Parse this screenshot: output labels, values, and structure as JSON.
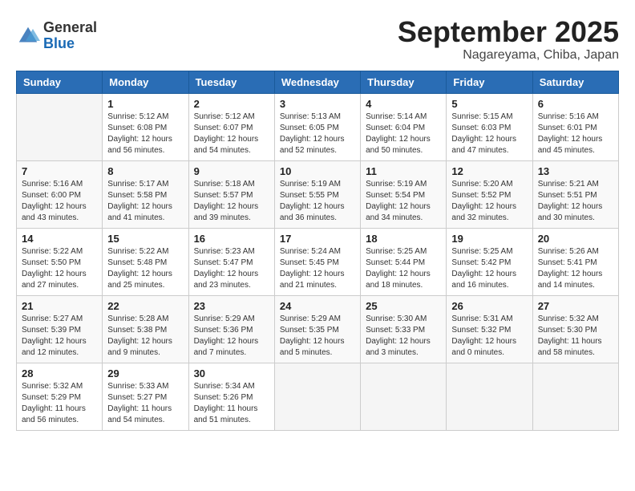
{
  "logo": {
    "general": "General",
    "blue": "Blue"
  },
  "title": "September 2025",
  "location": "Nagareyama, Chiba, Japan",
  "weekdays": [
    "Sunday",
    "Monday",
    "Tuesday",
    "Wednesday",
    "Thursday",
    "Friday",
    "Saturday"
  ],
  "weeks": [
    [
      {
        "day": "",
        "info": ""
      },
      {
        "day": "1",
        "info": "Sunrise: 5:12 AM\nSunset: 6:08 PM\nDaylight: 12 hours\nand 56 minutes."
      },
      {
        "day": "2",
        "info": "Sunrise: 5:12 AM\nSunset: 6:07 PM\nDaylight: 12 hours\nand 54 minutes."
      },
      {
        "day": "3",
        "info": "Sunrise: 5:13 AM\nSunset: 6:05 PM\nDaylight: 12 hours\nand 52 minutes."
      },
      {
        "day": "4",
        "info": "Sunrise: 5:14 AM\nSunset: 6:04 PM\nDaylight: 12 hours\nand 50 minutes."
      },
      {
        "day": "5",
        "info": "Sunrise: 5:15 AM\nSunset: 6:03 PM\nDaylight: 12 hours\nand 47 minutes."
      },
      {
        "day": "6",
        "info": "Sunrise: 5:16 AM\nSunset: 6:01 PM\nDaylight: 12 hours\nand 45 minutes."
      }
    ],
    [
      {
        "day": "7",
        "info": "Sunrise: 5:16 AM\nSunset: 6:00 PM\nDaylight: 12 hours\nand 43 minutes."
      },
      {
        "day": "8",
        "info": "Sunrise: 5:17 AM\nSunset: 5:58 PM\nDaylight: 12 hours\nand 41 minutes."
      },
      {
        "day": "9",
        "info": "Sunrise: 5:18 AM\nSunset: 5:57 PM\nDaylight: 12 hours\nand 39 minutes."
      },
      {
        "day": "10",
        "info": "Sunrise: 5:19 AM\nSunset: 5:55 PM\nDaylight: 12 hours\nand 36 minutes."
      },
      {
        "day": "11",
        "info": "Sunrise: 5:19 AM\nSunset: 5:54 PM\nDaylight: 12 hours\nand 34 minutes."
      },
      {
        "day": "12",
        "info": "Sunrise: 5:20 AM\nSunset: 5:52 PM\nDaylight: 12 hours\nand 32 minutes."
      },
      {
        "day": "13",
        "info": "Sunrise: 5:21 AM\nSunset: 5:51 PM\nDaylight: 12 hours\nand 30 minutes."
      }
    ],
    [
      {
        "day": "14",
        "info": "Sunrise: 5:22 AM\nSunset: 5:50 PM\nDaylight: 12 hours\nand 27 minutes."
      },
      {
        "day": "15",
        "info": "Sunrise: 5:22 AM\nSunset: 5:48 PM\nDaylight: 12 hours\nand 25 minutes."
      },
      {
        "day": "16",
        "info": "Sunrise: 5:23 AM\nSunset: 5:47 PM\nDaylight: 12 hours\nand 23 minutes."
      },
      {
        "day": "17",
        "info": "Sunrise: 5:24 AM\nSunset: 5:45 PM\nDaylight: 12 hours\nand 21 minutes."
      },
      {
        "day": "18",
        "info": "Sunrise: 5:25 AM\nSunset: 5:44 PM\nDaylight: 12 hours\nand 18 minutes."
      },
      {
        "day": "19",
        "info": "Sunrise: 5:25 AM\nSunset: 5:42 PM\nDaylight: 12 hours\nand 16 minutes."
      },
      {
        "day": "20",
        "info": "Sunrise: 5:26 AM\nSunset: 5:41 PM\nDaylight: 12 hours\nand 14 minutes."
      }
    ],
    [
      {
        "day": "21",
        "info": "Sunrise: 5:27 AM\nSunset: 5:39 PM\nDaylight: 12 hours\nand 12 minutes."
      },
      {
        "day": "22",
        "info": "Sunrise: 5:28 AM\nSunset: 5:38 PM\nDaylight: 12 hours\nand 9 minutes."
      },
      {
        "day": "23",
        "info": "Sunrise: 5:29 AM\nSunset: 5:36 PM\nDaylight: 12 hours\nand 7 minutes."
      },
      {
        "day": "24",
        "info": "Sunrise: 5:29 AM\nSunset: 5:35 PM\nDaylight: 12 hours\nand 5 minutes."
      },
      {
        "day": "25",
        "info": "Sunrise: 5:30 AM\nSunset: 5:33 PM\nDaylight: 12 hours\nand 3 minutes."
      },
      {
        "day": "26",
        "info": "Sunrise: 5:31 AM\nSunset: 5:32 PM\nDaylight: 12 hours\nand 0 minutes."
      },
      {
        "day": "27",
        "info": "Sunrise: 5:32 AM\nSunset: 5:30 PM\nDaylight: 11 hours\nand 58 minutes."
      }
    ],
    [
      {
        "day": "28",
        "info": "Sunrise: 5:32 AM\nSunset: 5:29 PM\nDaylight: 11 hours\nand 56 minutes."
      },
      {
        "day": "29",
        "info": "Sunrise: 5:33 AM\nSunset: 5:27 PM\nDaylight: 11 hours\nand 54 minutes."
      },
      {
        "day": "30",
        "info": "Sunrise: 5:34 AM\nSunset: 5:26 PM\nDaylight: 11 hours\nand 51 minutes."
      },
      {
        "day": "",
        "info": ""
      },
      {
        "day": "",
        "info": ""
      },
      {
        "day": "",
        "info": ""
      },
      {
        "day": "",
        "info": ""
      }
    ]
  ]
}
